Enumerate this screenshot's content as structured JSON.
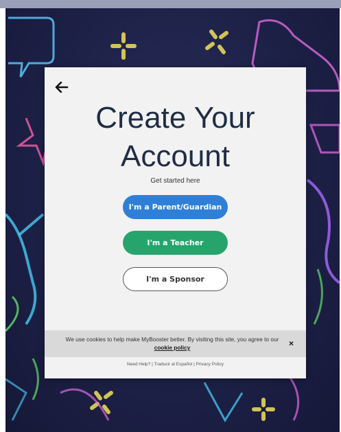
{
  "modal": {
    "title_line1": "Create Your",
    "title_line2": "Account",
    "subtitle": "Get started here",
    "buttons": {
      "parent": "I'm a Parent/Guardian",
      "teacher": "I'm a Teacher",
      "sponsor": "I'm a Sponsor"
    }
  },
  "cookie_banner": {
    "text": "We use cookies to help make MyBooster better. By visiting this site, you agree to our",
    "link": "cookie policy",
    "close": "×"
  },
  "footer": {
    "help": "Need Help?",
    "sep": "|",
    "spanish": "Traducir al Español",
    "privacy": "Privacy Policy"
  },
  "colors": {
    "parent_button": "#2f7fd8",
    "teacher_button": "#27a46c",
    "title": "#1f2d45",
    "background": "#1d2147"
  },
  "icons": [
    "back-arrow-icon",
    "close-icon"
  ]
}
